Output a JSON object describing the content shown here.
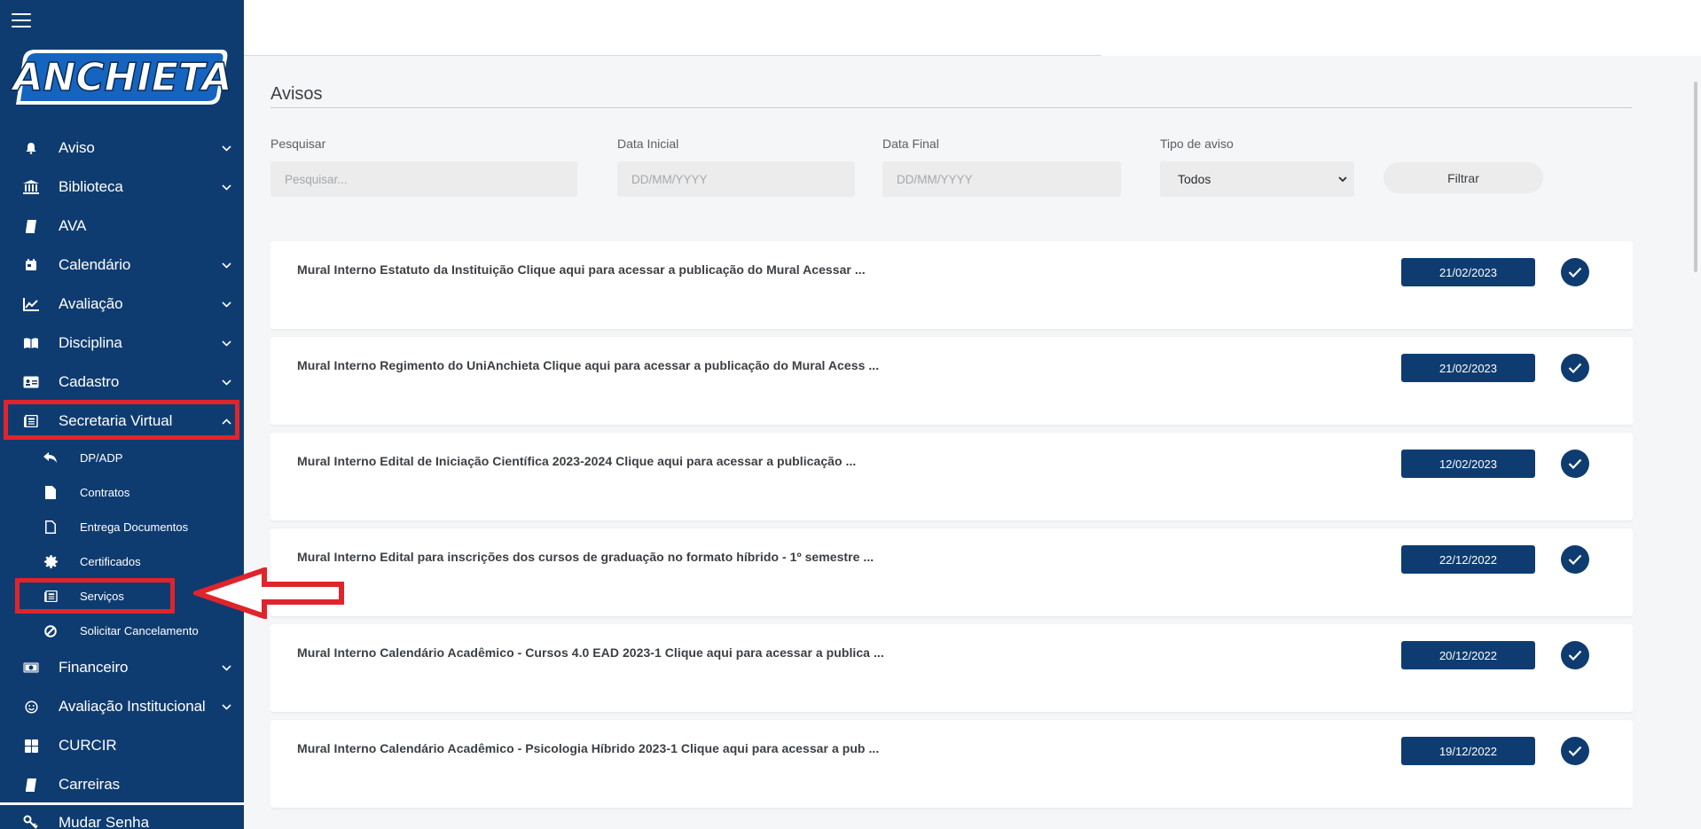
{
  "app": {
    "logo_text": "ANCHIETA"
  },
  "sidebar": {
    "items": [
      {
        "label": "Aviso",
        "icon": "bell-icon",
        "expandable": true
      },
      {
        "label": "Biblioteca",
        "icon": "library-icon",
        "expandable": true
      },
      {
        "label": "AVA",
        "icon": "book-icon",
        "expandable": false
      },
      {
        "label": "Calendário",
        "icon": "calendar-icon",
        "expandable": true
      },
      {
        "label": "Avaliação",
        "icon": "chart-line-icon",
        "expandable": true
      },
      {
        "label": "Disciplina",
        "icon": "open-book-icon",
        "expandable": true
      },
      {
        "label": "Cadastro",
        "icon": "id-card-icon",
        "expandable": true
      },
      {
        "label": "Secretaria Virtual",
        "icon": "newspaper-icon",
        "expandable": true,
        "expanded": true
      }
    ],
    "sub_items": [
      {
        "label": "DP/ADP",
        "icon": "reply-icon"
      },
      {
        "label": "Contratos",
        "icon": "file-icon"
      },
      {
        "label": "Entrega Documentos",
        "icon": "file-outline-icon"
      },
      {
        "label": "Certificados",
        "icon": "certificate-icon"
      },
      {
        "label": "Serviços",
        "icon": "newspaper-icon"
      },
      {
        "label": "Solicitar Cancelamento",
        "icon": "ban-icon"
      }
    ],
    "items_after": [
      {
        "label": "Financeiro",
        "icon": "money-icon",
        "expandable": true
      },
      {
        "label": "Avaliação Institucional",
        "icon": "smile-icon",
        "expandable": true
      },
      {
        "label": "CURCIR",
        "icon": "grid-icon",
        "expandable": false
      },
      {
        "label": "Carreiras",
        "icon": "book-icon",
        "expandable": false
      }
    ],
    "bottom_item": {
      "label": "Mudar Senha",
      "icon": "key-icon"
    }
  },
  "main": {
    "title": "Avisos",
    "filters": {
      "search_label": "Pesquisar",
      "search_placeholder": "Pesquisar...",
      "start_label": "Data Inicial",
      "start_placeholder": "DD/MM/YYYY",
      "end_label": "Data Final",
      "end_placeholder": "DD/MM/YYYY",
      "type_label": "Tipo de aviso",
      "type_value": "Todos",
      "filter_button": "Filtrar"
    },
    "notices": [
      {
        "text": "Mural Interno Estatuto da Instituição Clique aqui para acessar a publicação do Mural Acessar ...",
        "date": "21/02/2023"
      },
      {
        "text": "Mural Interno Regimento do UniAnchieta Clique aqui para acessar a publicação do Mural Acess ...",
        "date": "21/02/2023"
      },
      {
        "text": "Mural Interno Edital de Iniciação Científica 2023-2024 Clique aqui para acessar a publicação ...",
        "date": "12/02/2023"
      },
      {
        "text": "Mural Interno Edital para inscrições dos cursos de graduação no formato híbrido - 1º semestre ...",
        "date": "22/12/2022"
      },
      {
        "text": "Mural Interno Calendário Acadêmico - Cursos 4.0 EAD 2023-1 Clique aqui para acessar a publica ...",
        "date": "20/12/2022"
      },
      {
        "text": "Mural Interno Calendário Acadêmico - Psicologia Híbrido 2023-1 Clique aqui para acessar a pub ...",
        "date": "19/12/2022"
      }
    ]
  },
  "colors": {
    "brand_navy": "#0f3c70",
    "annotation_red": "#e0242b"
  }
}
